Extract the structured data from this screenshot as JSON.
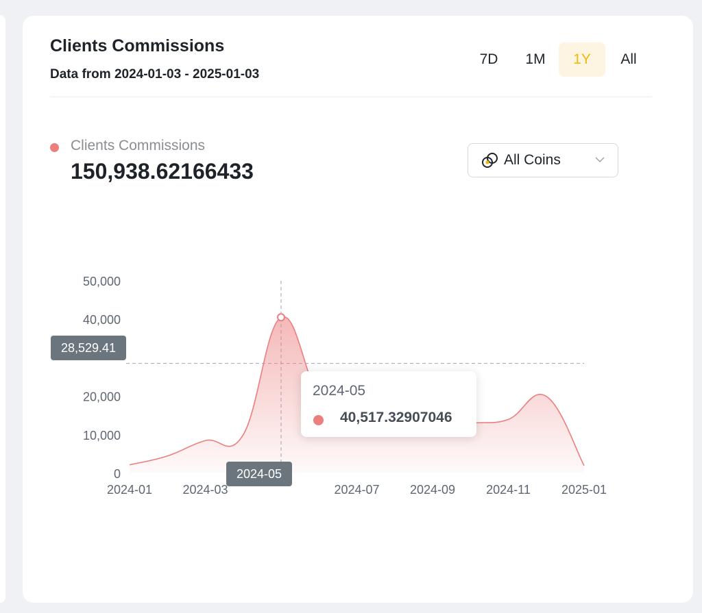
{
  "header": {
    "title": "Clients Commissions",
    "subtitle": "Data from 2024-01-03 - 2025-01-03"
  },
  "range_tabs": [
    {
      "label": "7D",
      "active": false
    },
    {
      "label": "1M",
      "active": false
    },
    {
      "label": "1Y",
      "active": true
    },
    {
      "label": "All",
      "active": false
    }
  ],
  "metric": {
    "label": "Clients Commissions",
    "value": "150,938.62166433"
  },
  "coin_select": {
    "selected": "All Coins",
    "icon": "coins-icon"
  },
  "colors": {
    "series": "#ec7e7e",
    "accent": "#f0b90b",
    "active_tab_bg": "#fdf4e2",
    "pointer_badge": "#6b757d"
  },
  "chart_data": {
    "type": "area",
    "x_tick_labels": [
      "2024-01",
      "2024-03",
      "2024-05",
      "2024-07",
      "2024-09",
      "2024-11",
      "2025-01"
    ],
    "y_tick_labels": [
      "0",
      "10,000",
      "20,000",
      "40,000",
      "50,000"
    ],
    "ylim": [
      0,
      50000
    ],
    "grid": false,
    "series": [
      {
        "values_x": [
          "2024-01",
          "2024-02",
          "2024-03",
          "2024-04",
          "2024-05",
          "2024-06",
          "2024-07",
          "2024-08",
          "2024-09",
          "2024-10",
          "2024-11",
          "2024-12",
          "2025-01"
        ],
        "values_y": [
          2200,
          4500,
          8500,
          10000,
          40517,
          20000,
          12000,
          11000,
          11500,
          13000,
          14000,
          20000,
          2000
        ]
      }
    ],
    "crosshair": {
      "x": "2024-05",
      "y_label": "28,529.41",
      "x_label": "2024-05"
    },
    "tooltip": {
      "date": "2024-05",
      "value": "40,517.32907046"
    }
  }
}
